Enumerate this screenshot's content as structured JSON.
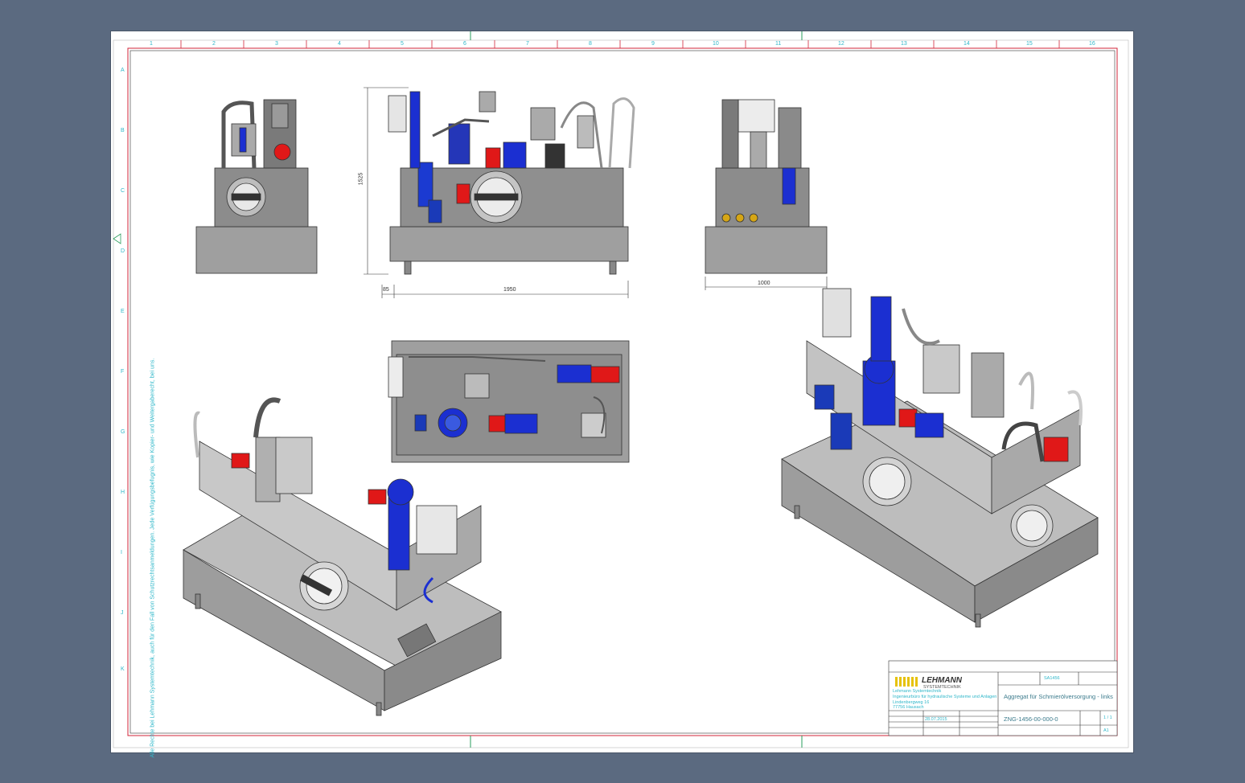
{
  "drawing": {
    "dimensions": {
      "height": "1525",
      "offset": "85",
      "length": "1950",
      "width": "1000"
    },
    "brand_label": "LEHMANN",
    "side_notice": "Alle Rechte bei Lehmann Systemtechnik, auch für den Fall von Schutzrechtsanmeldungen. Jede Verfügungsbefugnis, wie Kopier- und Weitergaberecht, bei uns.",
    "zones_top": [
      "1",
      "2",
      "3",
      "4",
      "5",
      "6",
      "7",
      "8",
      "9",
      "10",
      "11",
      "12",
      "13",
      "14",
      "15",
      "16"
    ],
    "zones_side": [
      "A",
      "B",
      "C",
      "D",
      "E",
      "F",
      "G",
      "H",
      "I",
      "J",
      "K"
    ]
  },
  "title_block": {
    "logo_name": "LEHMANN",
    "logo_sub": "SYSTEMTECHNIK",
    "company_name": "Lehmann Systemtechnik",
    "company_line1": "Ingenieurbüro für hydraulische Systeme und Anlagen",
    "company_line2": "Lindenbergweg 16",
    "company_line3": "77756 Hausach",
    "title": "Aggregat für Schmierölversorgung - links",
    "drawing_number": "ZNG-1456-00-000-0",
    "order_no": "SA1456",
    "sheet": "1 / 1",
    "format": "A1",
    "date": "28.07.2015"
  },
  "colors": {
    "background": "#5b6a80",
    "sheet": "#ffffff",
    "frame_line": "#d2263a",
    "annotation": "#2fb7c9",
    "tank_gray": "#9a9a9a",
    "motor_blue": "#1b2fd1",
    "valve_red": "#e01818",
    "filter_blue": "#1a3ab8"
  }
}
